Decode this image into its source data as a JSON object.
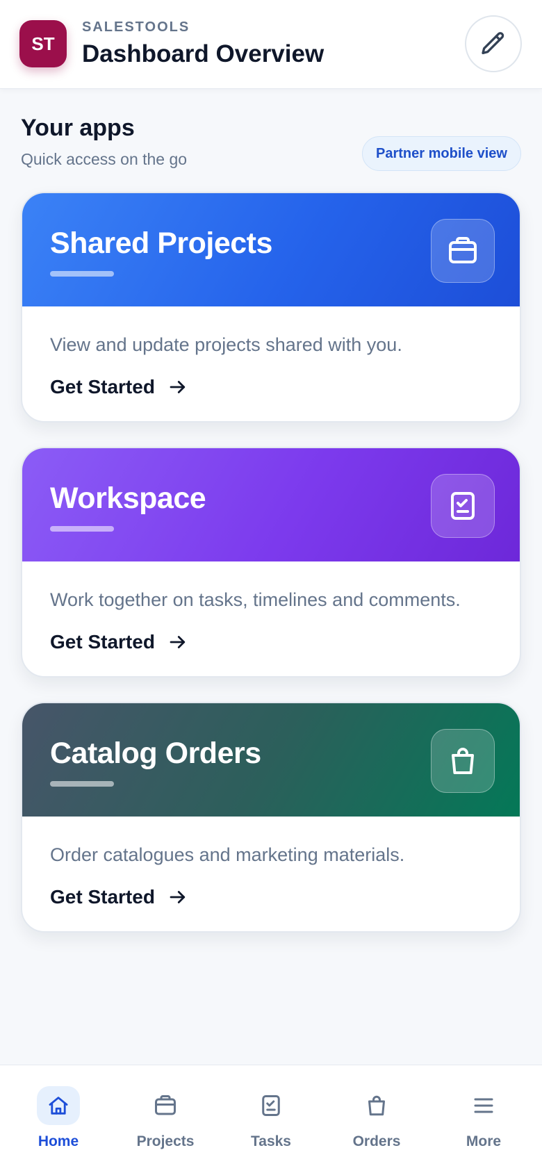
{
  "header": {
    "avatar_initials": "ST",
    "brand": "SALESTOOLS",
    "title": "Dashboard Overview",
    "edit_icon": "pencil-icon"
  },
  "section": {
    "title": "Your apps",
    "subtitle": "Quick access on the go",
    "partner_pill": "Partner mobile view"
  },
  "cards": [
    {
      "title": "Shared Projects",
      "description": "View and update projects shared with you.",
      "cta": "Get Started",
      "icon": "briefcase-icon",
      "accent": "#2563eb"
    },
    {
      "title": "Workspace",
      "description": "Work together on tasks, timelines and comments.",
      "cta": "Get Started",
      "icon": "clipboard-check-icon",
      "accent": "#7c3aed"
    },
    {
      "title": "Catalog Orders",
      "description": "Order catalogues and marketing materials.",
      "cta": "Get Started",
      "icon": "shopping-bag-icon",
      "accent": "#047857"
    }
  ],
  "nav": {
    "items": [
      {
        "label": "Home",
        "icon": "home-icon",
        "active": true
      },
      {
        "label": "Projects",
        "icon": "briefcase-icon",
        "active": false
      },
      {
        "label": "Tasks",
        "icon": "clipboard-check-icon",
        "active": false
      },
      {
        "label": "Orders",
        "icon": "shopping-bag-icon",
        "active": false
      },
      {
        "label": "More",
        "icon": "menu-icon",
        "active": false
      }
    ]
  },
  "colors": {
    "brand": "#9b0f4b",
    "active_nav": "#1d4ed8",
    "muted_text": "#64748b"
  }
}
